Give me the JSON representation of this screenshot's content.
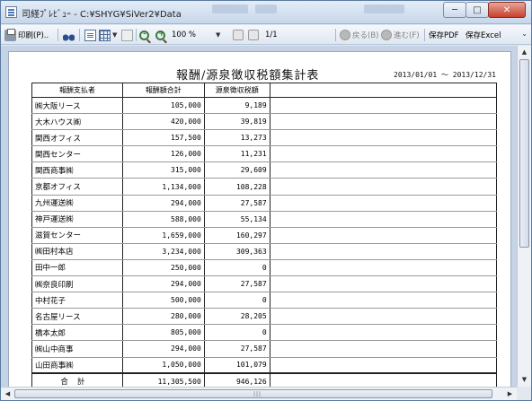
{
  "window": {
    "title": "司経ﾌﾟﾚﾋﾞｭｰ - C:¥SHYG¥SiVer2¥Data",
    "minimize": "─",
    "maximize": "□",
    "close": "✕"
  },
  "toolbar": {
    "print_label": "印刷(P)..",
    "zoom_value": "100 %",
    "page_indicator": "1/1",
    "back_label": "戻る(B)",
    "forward_label": "進む(F)",
    "save_pdf_label": "保存PDF",
    "save_excel_label": "保存Excel",
    "caret": "▼",
    "overflow": "⌄"
  },
  "report": {
    "title": "報酬/源泉徴収税額集計表",
    "period": "2013/01/01 ～ 2013/12/31",
    "columns": [
      "報酬支払者",
      "報酬額合計",
      "源泉徴収税額",
      ""
    ],
    "rows": [
      {
        "payer": "㈱大阪リース",
        "amount": "105,000",
        "tax": "9,189"
      },
      {
        "payer": "大木ハウス㈱",
        "amount": "420,000",
        "tax": "39,819"
      },
      {
        "payer": "関西オフィス",
        "amount": "157,500",
        "tax": "13,273"
      },
      {
        "payer": "関西センター",
        "amount": "126,000",
        "tax": "11,231"
      },
      {
        "payer": "関西商事㈱",
        "amount": "315,000",
        "tax": "29,609"
      },
      {
        "payer": "京都オフィス",
        "amount": "1,134,000",
        "tax": "108,228"
      },
      {
        "payer": "九州運送㈱",
        "amount": "294,000",
        "tax": "27,587"
      },
      {
        "payer": "神戸運送㈱",
        "amount": "588,000",
        "tax": "55,134"
      },
      {
        "payer": "滋賀センター",
        "amount": "1,659,000",
        "tax": "160,297"
      },
      {
        "payer": "㈱田村本店",
        "amount": "3,234,000",
        "tax": "309,363"
      },
      {
        "payer": "田中一郎",
        "amount": "250,000",
        "tax": "0"
      },
      {
        "payer": "㈱奈良印刷",
        "amount": "294,000",
        "tax": "27,587"
      },
      {
        "payer": "中村花子",
        "amount": "500,000",
        "tax": "0"
      },
      {
        "payer": "名古屋リース",
        "amount": "280,000",
        "tax": "28,205"
      },
      {
        "payer": "橋本太郎",
        "amount": "805,000",
        "tax": "0"
      },
      {
        "payer": "㈱山中商事",
        "amount": "294,000",
        "tax": "27,587"
      },
      {
        "payer": "山田商事㈱",
        "amount": "1,050,000",
        "tax": "101,079"
      }
    ],
    "total": {
      "label": "合計",
      "amount": "11,305,500",
      "tax": "946,126"
    }
  },
  "scroll": {
    "up": "▲",
    "down": "▼",
    "left": "◀",
    "right": "▶",
    "grip": "|||"
  }
}
